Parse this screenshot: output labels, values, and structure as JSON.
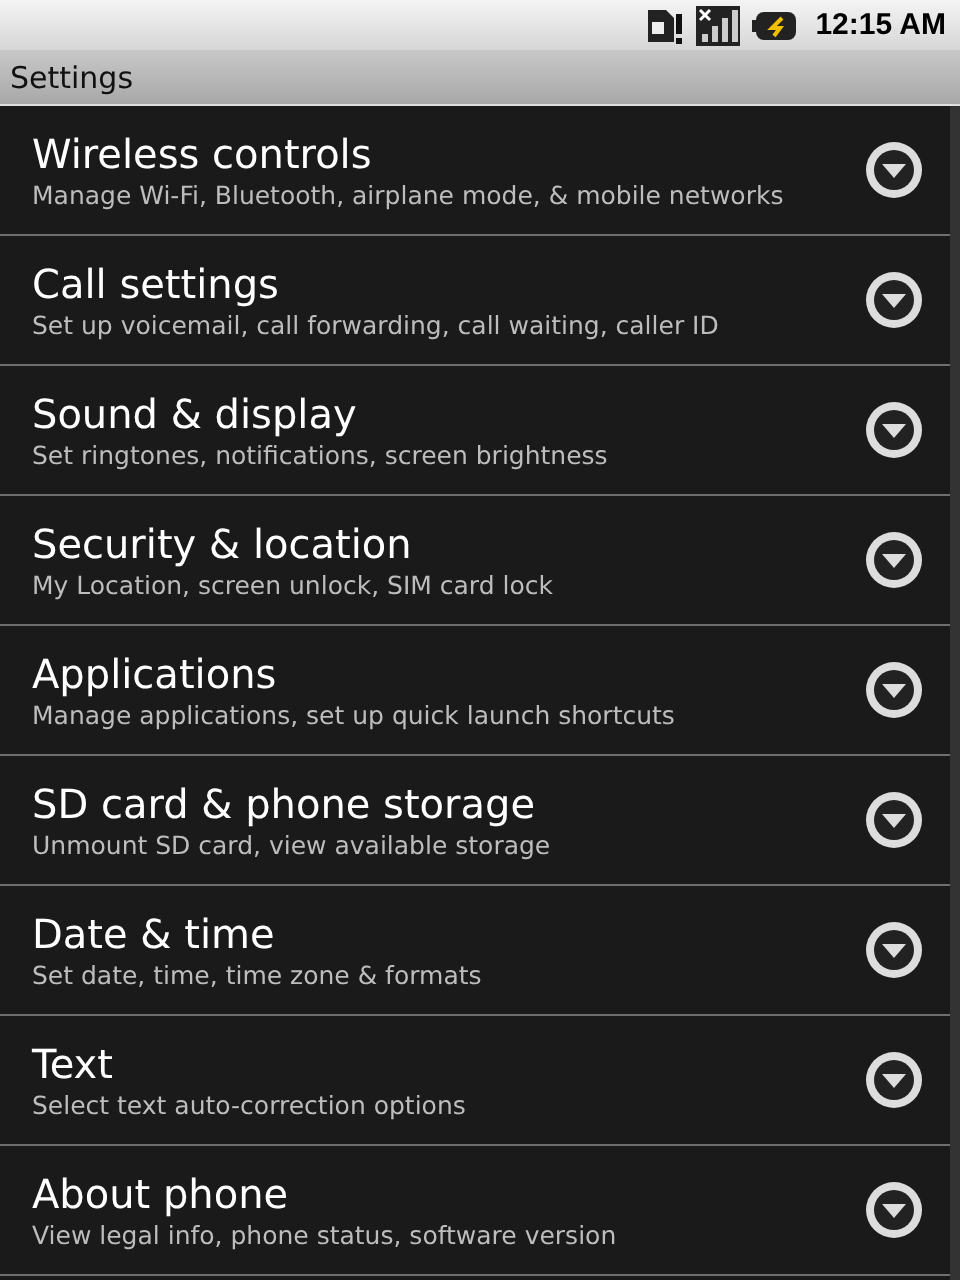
{
  "status_bar": {
    "time": "12:15 AM"
  },
  "title_bar": {
    "title": "Settings"
  },
  "items": [
    {
      "title": "Wireless controls",
      "summary": "Manage Wi-Fi, Bluetooth, airplane mode, & mobile networks"
    },
    {
      "title": "Call settings",
      "summary": "Set up voicemail, call forwarding, call waiting, caller ID"
    },
    {
      "title": "Sound & display",
      "summary": "Set ringtones, notifications, screen brightness"
    },
    {
      "title": "Security & location",
      "summary": "My Location, screen unlock, SIM card lock"
    },
    {
      "title": "Applications",
      "summary": "Manage applications, set up quick launch shortcuts"
    },
    {
      "title": "SD card & phone storage",
      "summary": "Unmount SD card, view available storage"
    },
    {
      "title": "Date & time",
      "summary": "Set date, time, time zone & formats"
    },
    {
      "title": "Text",
      "summary": "Select text auto-correction options"
    },
    {
      "title": "About phone",
      "summary": "View legal info, phone status, software version"
    }
  ]
}
